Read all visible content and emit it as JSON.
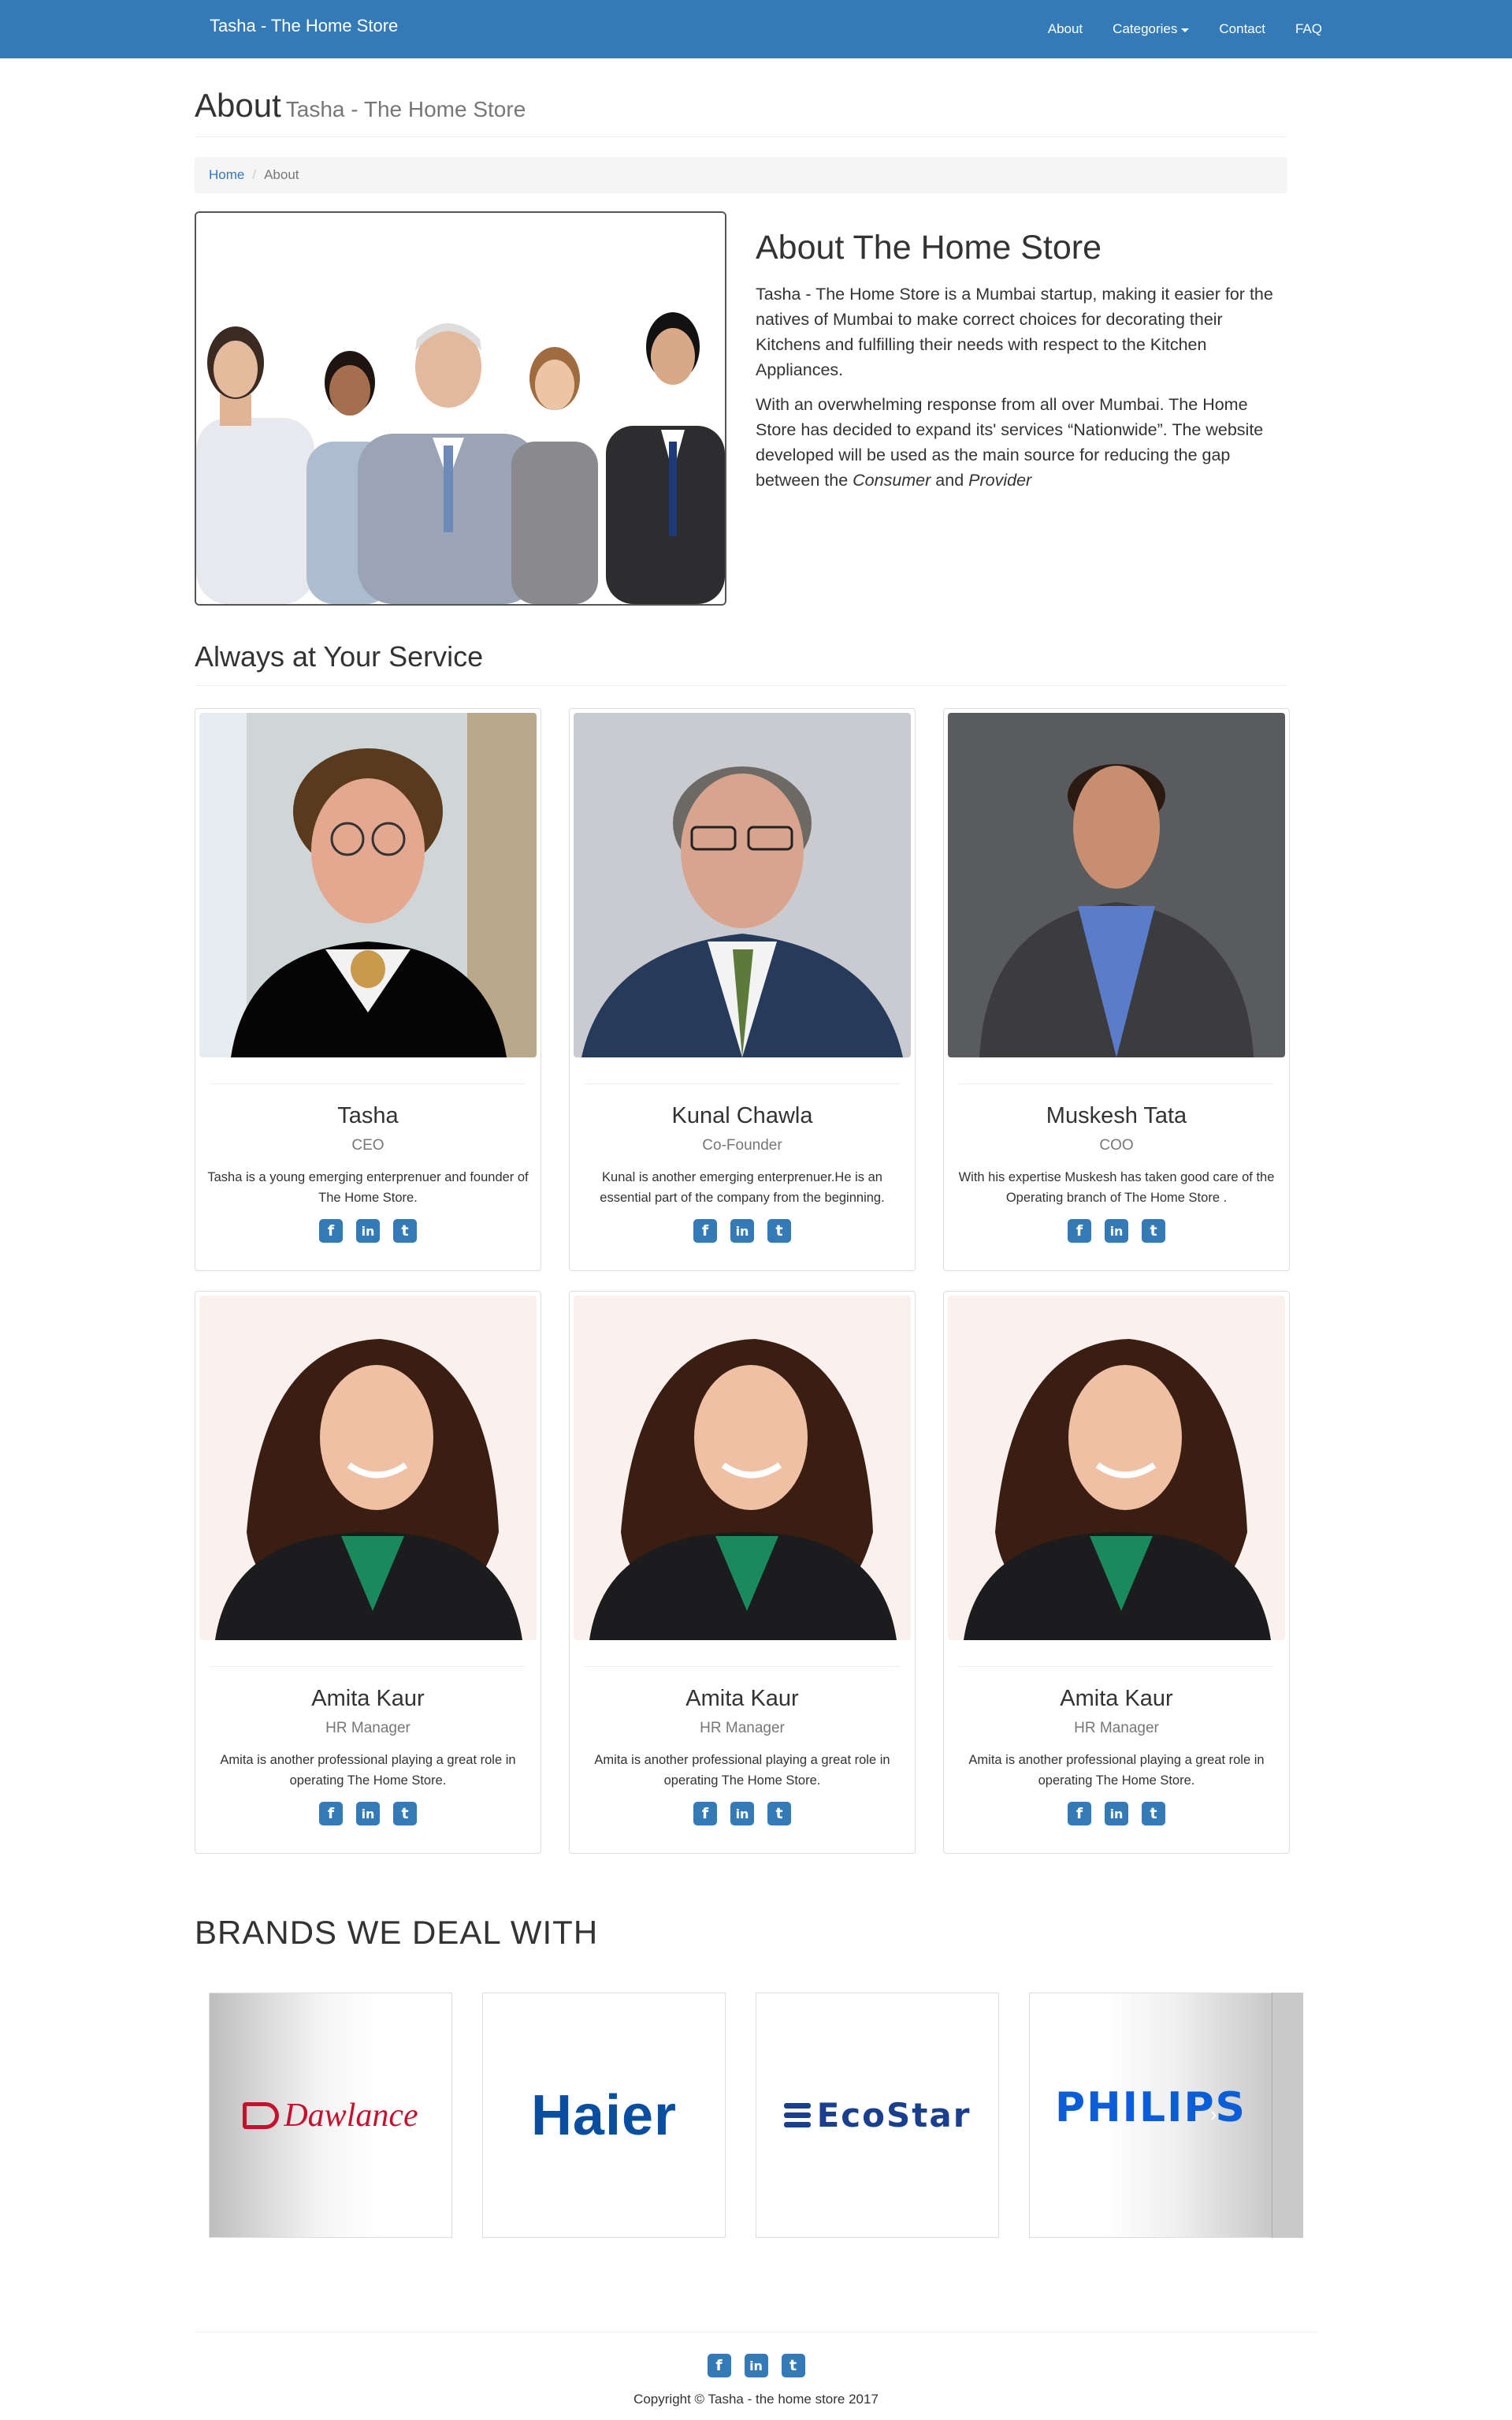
{
  "nav": {
    "brand": "Tasha - The Home Store",
    "links": [
      "About",
      "Categories",
      "Contact",
      "FAQ"
    ]
  },
  "header": {
    "title": "About",
    "subtitle": "Tasha - The Home Store"
  },
  "breadcrumb": {
    "home": "Home",
    "current": "About"
  },
  "intro": {
    "heading": "About The Home Store",
    "p1": "Tasha - The Home Store is a Mumbai startup, making it easier for the natives of Mumbai to make correct choices for decorating their Kitchens and fulfilling their needs with respect to the Kitchen Appliances.",
    "p2_a": "With an overwhelming response from all over Mumbai. The Home Store has decided to expand its' services “Nationwide”. The website developed will be used as the main source for reducing the gap between the ",
    "p2_em1": "Consumer",
    "p2_and": " and ",
    "p2_em2": "Provider"
  },
  "team": {
    "heading": "Always at Your Service",
    "members": [
      {
        "name": "Tasha",
        "role": "CEO",
        "bio": "Tasha is a young emerging enterprenuer and founder of The Home Store."
      },
      {
        "name": "Kunal Chawla",
        "role": "Co-Founder",
        "bio": "Kunal is another emerging enterprenuer.He is an essential part of the company from the beginning."
      },
      {
        "name": "Muskesh Tata",
        "role": "COO",
        "bio": "With his expertise Muskesh has taken good care of the Operating branch of The Home Store ."
      },
      {
        "name": "Amita Kaur",
        "role": "HR Manager",
        "bio": "Amita is another professional playing a great role in operating The Home Store."
      },
      {
        "name": "Amita Kaur",
        "role": "HR Manager",
        "bio": "Amita is another professional playing a great role in operating The Home Store."
      },
      {
        "name": "Amita Kaur",
        "role": "HR Manager",
        "bio": "Amita is another professional playing a great role in operating The Home Store."
      }
    ]
  },
  "brands": {
    "heading": "BRANDS WE DEAL WITH",
    "items": [
      "Dawlance",
      "Haier",
      "EcoStar",
      "PHILIPS"
    ]
  },
  "social": {
    "facebook": "f",
    "linkedin": "in",
    "twitter": "t"
  },
  "footer": {
    "copyright": "Copyright © Tasha - the home store 2017"
  },
  "colors": {
    "primary": "#337ab7",
    "dawlance": "#c8102e",
    "haier": "#0a4ea2",
    "ecostar": "#1a3f8f",
    "philips": "#0b5ed7"
  }
}
